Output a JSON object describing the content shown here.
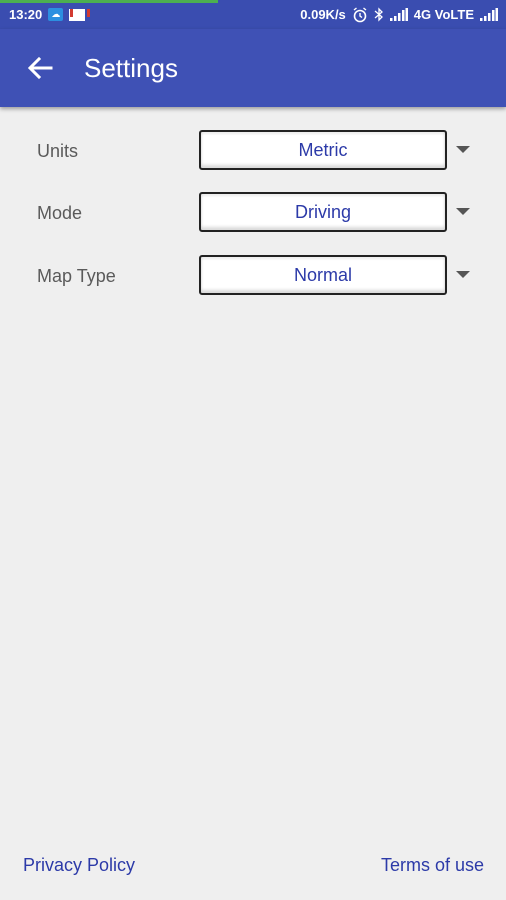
{
  "status_bar": {
    "time": "13:20",
    "speed": "0.09K/s",
    "network": "4G VoLTE",
    "icons": [
      "cloud-icon",
      "gmail-icon",
      "alarm-icon",
      "bluetooth-icon",
      "signal-icon",
      "signal-icon"
    ]
  },
  "app_bar": {
    "title": "Settings",
    "back_icon": "arrow-back-icon"
  },
  "settings": [
    {
      "label": "Units",
      "value": "Metric"
    },
    {
      "label": "Mode",
      "value": "Driving"
    },
    {
      "label": "Map Type",
      "value": "Normal"
    }
  ],
  "footer": {
    "privacy_label": "Privacy Policy",
    "terms_label": "Terms of use"
  },
  "colors": {
    "primary": "#3f51b5",
    "status_bar": "#3a4db0",
    "link": "#2c3aa8",
    "background": "#efefef"
  }
}
